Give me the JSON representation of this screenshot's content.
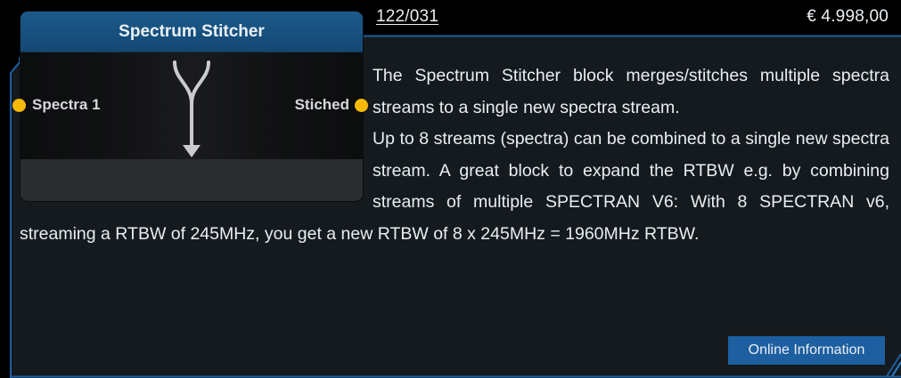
{
  "product": {
    "article_number": "122/031",
    "price": "€ 4.998,00",
    "description_p1": "The Spectrum Stitcher block merges/stitches multiple spectra streams to a single new spectra stream.",
    "description_p2": "Up to 8 streams (spectra) can be combined to a single new spectra stream. A great block to expand the RTBW e.g. by combining streams of multiple SPECTRAN V6: With 8 SPECTRAN v6, streaming a RTBW of 245MHz, you get a new RTBW of 8 x 245MHz = 1960MHz RTBW.",
    "online_info_label": "Online Information"
  },
  "node": {
    "title": "Spectrum Stitcher",
    "input_port": "Spectra 1",
    "output_port": "Stiched",
    "icon": "merge-arrow-icon"
  },
  "colors": {
    "page_background": "#000000",
    "panel_background": "#141a1e",
    "panel_border": "#1d5fa0",
    "node_header": "#1b5a8a",
    "port": "#f7b90a",
    "button": "#1d5fa0",
    "text": "#e9eef2"
  }
}
